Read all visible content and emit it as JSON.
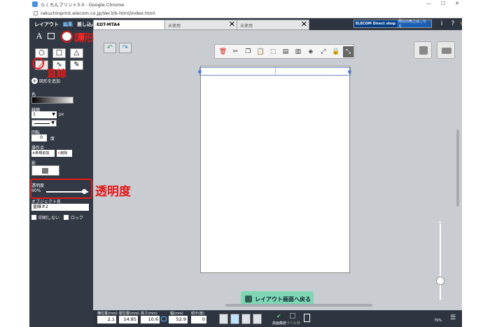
{
  "browser": {
    "title": "らくちんプリント3.0 - Google Chrome",
    "url": "rakuchinprint.elecom.co.jp/Ver3/b-html/index.html"
  },
  "appbar": {
    "tab_layout": "レイアウト",
    "tab_edit": "編集",
    "tab_merge": "差し込み",
    "doc_tabs": [
      {
        "label": "EDT-MTA4",
        "active": true
      },
      {
        "label": "未使用",
        "active": false
      },
      {
        "label": "未使用",
        "active": false
      }
    ],
    "elecom_brand": "ELECOM",
    "elecom_sub": "Direct shop",
    "elecom_link": "周辺の売上はこちら"
  },
  "sidebar": {
    "add_shape_label": "図形を追加",
    "color_label": "色",
    "line_width_label": "線幅",
    "line_width_value": "1",
    "line_width_unit": "px",
    "rotation_label": "回転",
    "rotation_value": "0",
    "rotation_unit": "度",
    "operation_label": "操作点",
    "add_new_label": "新規追加",
    "delete_label": "削除",
    "shadow_label": "影",
    "opacity_label": "透明度",
    "opacity_value": "90%",
    "opacity_fraction": 0.9,
    "object_name_label": "オブジェクト名",
    "object_name_value": "直線＃2",
    "no_print_label": "印刷しない",
    "lock_label": "ロック"
  },
  "annotations": {
    "shape": "図形",
    "line": "直線",
    "opacity": "透明度"
  },
  "canvas": {
    "back_button": "レイアウト画面へ戻る"
  },
  "statusbar": {
    "x_label": "横位置(mm)",
    "x_value": "2.1",
    "y_label": "縦位置(mm)",
    "y_value": "14.85",
    "h_label": "高さ(mm)",
    "h_value": "10.6",
    "w_label": "幅(mm)",
    "w_value": "52.9",
    "tilt_label": "傾き(度)",
    "tilt_value": "0",
    "hq_label": "高画像度",
    "label_label": "ラベル枠",
    "zoom_value": "79%"
  }
}
